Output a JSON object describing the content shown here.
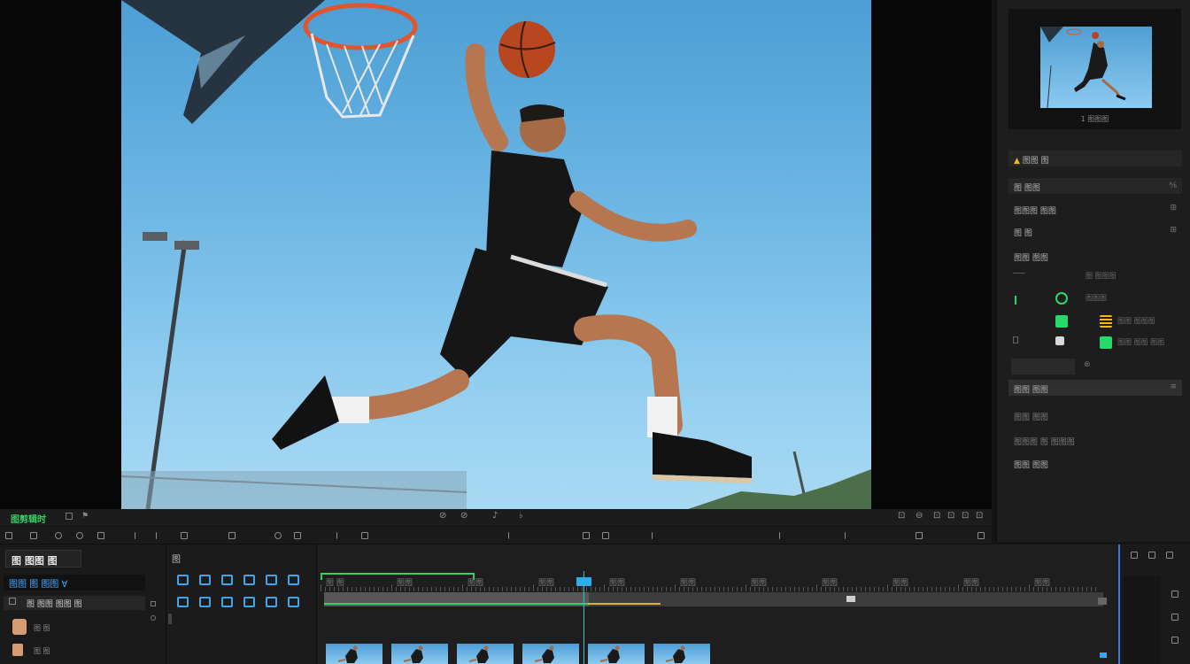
{
  "viewer": {
    "timecode": "图剪辑时",
    "transport_labels": [
      "⊘",
      "⊘",
      "♪",
      "♭"
    ],
    "right_icon_labels": [
      "⊡",
      "⊖",
      "⊡",
      "⊡",
      "⊡",
      "⊡"
    ]
  },
  "inspector": {
    "thumbnail_caption": "1 图图图",
    "rows": [
      {
        "label": "图图 图",
        "right": ""
      },
      {
        "label": "图 图图",
        "right": "⅍"
      },
      {
        "label": "图图图 图图",
        "right": "⊞"
      },
      {
        "label": "图 图",
        "right": "⊞"
      },
      {
        "label": "图图 图图",
        "right": ""
      },
      {
        "label": "图 图图图",
        "right": ""
      },
      {
        "label": "图图图",
        "right": ""
      },
      {
        "label": "图图 图图图",
        "right": ""
      },
      {
        "label": "图图 图图 图图",
        "right": ""
      },
      {
        "label": "图图 图图",
        "right": ""
      },
      {
        "label": "图图 图图",
        "right": "⊗"
      },
      {
        "label": "图图图 图 图图图",
        "right": ""
      },
      {
        "label": "图图 图图",
        "right": ""
      }
    ],
    "swatch_colors": {
      "green": "#28d86a",
      "yellow": "#f0b81c"
    }
  },
  "left_panel": {
    "title": "图 图图 图",
    "search_value": "图图 图 图图 ∀",
    "filter_label": "图 图图 图图 图",
    "items": [
      "图 图",
      "图 图"
    ]
  },
  "tools": {
    "header": "图",
    "icon_names": [
      "image-tool",
      "shape-tool",
      "pen-tool",
      "crop-tool",
      "magic-tool",
      "circle-tool",
      "text-tool",
      "layer-tool",
      "transform-tool",
      "mask-tool",
      "audio-tool",
      "effect-tool"
    ]
  },
  "timeline": {
    "ruler_labels": [
      "图 图",
      "图图",
      "图图",
      "图图",
      "图图",
      "图图",
      "图图",
      "图图",
      "图图",
      "图图",
      "图图"
    ],
    "progress_fraction": 0.34,
    "clip_count": 6
  },
  "colors": {
    "accent_green": "#35d063",
    "accent_blue": "#3ea5ea",
    "playhead": "#1fc6d6"
  }
}
